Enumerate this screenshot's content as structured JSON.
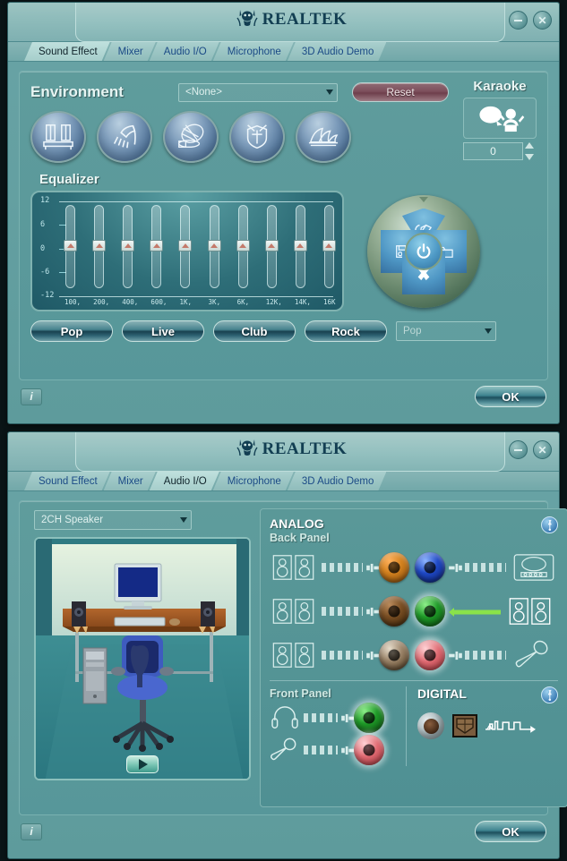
{
  "app": {
    "brand": "REALTEK",
    "logo_icon": "realtek-logo-icon"
  },
  "window_controls": {
    "minimize_label": "",
    "minimize_icon": "minimize-icon",
    "close_label": "✕",
    "close_icon": "close-icon"
  },
  "tabs": [
    {
      "label": "Sound Effect"
    },
    {
      "label": "Mixer"
    },
    {
      "label": "Audio I/O"
    },
    {
      "label": "Microphone"
    },
    {
      "label": "3D Audio Demo"
    }
  ],
  "panel1": {
    "active_tab": "Sound Effect",
    "environment": {
      "title": "Environment",
      "selected": "<None>",
      "reset_label": "Reset",
      "presets": [
        {
          "name": "bathroom-icon"
        },
        {
          "name": "shower-icon"
        },
        {
          "name": "stone-room-icon"
        },
        {
          "name": "padded-cell-icon"
        },
        {
          "name": "concert-hall-icon"
        }
      ]
    },
    "karaoke": {
      "title": "Karaoke",
      "icon": "karaoke-singer-icon",
      "value": "0",
      "up_icon": "spinner-up-icon",
      "down_icon": "spinner-down-icon"
    },
    "equalizer": {
      "title": "Equalizer",
      "db_labels": [
        "12",
        "6",
        "0",
        "-6",
        "-12"
      ],
      "bands": [
        {
          "freq": "100,",
          "value": 0
        },
        {
          "freq": "200,",
          "value": 0
        },
        {
          "freq": "400,",
          "value": 0
        },
        {
          "freq": "600,",
          "value": 0
        },
        {
          "freq": "1K,",
          "value": 0
        },
        {
          "freq": "3K,",
          "value": 0
        },
        {
          "freq": "6K,",
          "value": 0
        },
        {
          "freq": "12K,",
          "value": 0
        },
        {
          "freq": "14K,",
          "value": 0
        },
        {
          "freq": "16K",
          "value": 0
        }
      ]
    },
    "dialpad": {
      "top_icon": "eraser-icon",
      "left_icon": "save-floppy-icon",
      "right_icon": "open-folder-icon",
      "bottom_icon": "delete-x-icon",
      "center_icon": "power-icon"
    },
    "preset_buttons": [
      {
        "label": "Pop"
      },
      {
        "label": "Live"
      },
      {
        "label": "Club"
      },
      {
        "label": "Rock"
      }
    ],
    "preset_combo": {
      "selected": "Pop"
    },
    "footer": {
      "info_label": "i",
      "info_icon": "info-icon",
      "ok_label": "OK"
    }
  },
  "panel2": {
    "active_tab": "Audio I/O",
    "speaker_config": {
      "selected": "2CH Speaker"
    },
    "room_preview": {
      "icon": "room-speaker-layout-image",
      "play_icon": "play-icon"
    },
    "analog": {
      "title": "ANALOG",
      "back_panel_title": "Back Panel",
      "settings_icon": "wrench-settings-icon",
      "left_jacks": [
        {
          "color": "#c9781f",
          "device_icon": "speaker-pair-icon",
          "name": "orange-jack"
        },
        {
          "color": "#6e4a2a",
          "device_icon": "speaker-pair-icon",
          "name": "brown-jack"
        },
        {
          "color": "#8a7560",
          "device_icon": "speaker-pair-icon",
          "name": "grey-jack"
        }
      ],
      "right_jacks": [
        {
          "color": "#1f49c6",
          "device_icon": "line-in-icon",
          "name": "blue-jack",
          "connected": false
        },
        {
          "color": "#1f9a28",
          "device_icon": "speaker-pair-icon",
          "name": "green-jack",
          "connected": true
        },
        {
          "color": "#e06a72",
          "device_icon": "microphone-icon",
          "name": "pink-jack",
          "connected": false
        }
      ],
      "front_panel_title": "Front Panel",
      "front_jacks": [
        {
          "color": "#1f9a28",
          "device_icon": "headphone-icon",
          "name": "front-green-jack"
        },
        {
          "color": "#e06a72",
          "device_icon": "microphone-icon",
          "name": "front-pink-jack"
        }
      ]
    },
    "digital": {
      "title": "DIGITAL",
      "settings_icon": "wrench-settings-icon",
      "coax_icon": "coaxial-spdif-icon",
      "optical_icon": "optical-spdif-icon",
      "waveform_icon": "spdif-waveform-icon"
    },
    "footer": {
      "info_label": "i",
      "info_icon": "info-icon",
      "ok_label": "OK"
    }
  },
  "colors": {
    "window_bg": "#5e9b9c",
    "panel_bg": "#57979a",
    "tab_text": "#1b4a86",
    "tab_active_text": "#10242b",
    "brand": "#123e52",
    "accent_green": "#8ae24a"
  }
}
